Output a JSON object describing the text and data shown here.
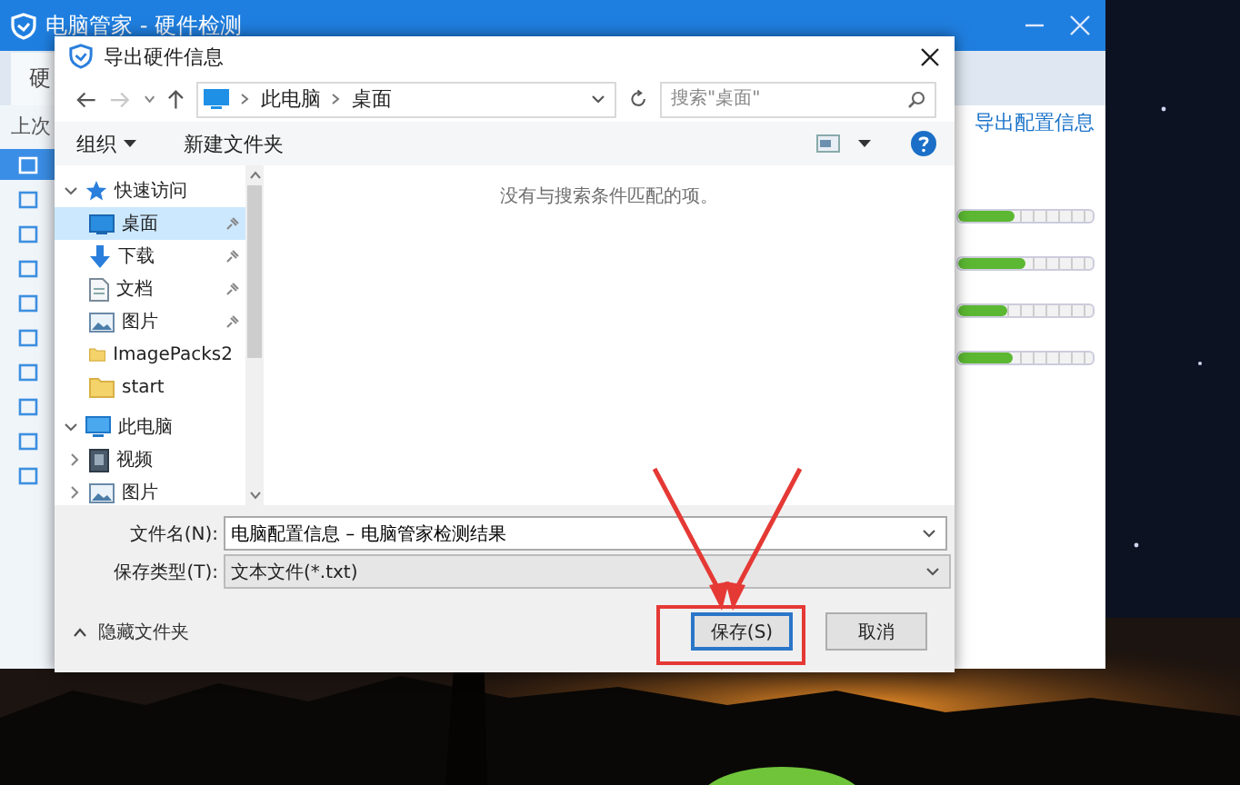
{
  "app_window": {
    "title": "电脑管家 - 硬件检测",
    "tabs": [
      {
        "label": "硬",
        "selected": true
      }
    ],
    "section_label": "上次",
    "sidebar": [
      {
        "selected": true
      },
      {
        "selected": false
      },
      {
        "selected": false
      },
      {
        "selected": false
      },
      {
        "selected": false
      },
      {
        "selected": false
      },
      {
        "selected": false
      },
      {
        "selected": false
      },
      {
        "selected": false
      },
      {
        "selected": false
      }
    ],
    "export_link": "导出配置信息",
    "meters": [
      {
        "level": 0.42
      },
      {
        "level": 0.5
      },
      {
        "level": 0.36
      },
      {
        "level": 0.4
      }
    ]
  },
  "dialog": {
    "title": "导出硬件信息",
    "breadcrumb": [
      "此电脑",
      "桌面"
    ],
    "search": {
      "placeholder": "搜索\"桌面\""
    },
    "toolbar": {
      "organize": "组织",
      "new_folder": "新建文件夹"
    },
    "nav": [
      {
        "label": "快速访问",
        "kind": "star",
        "expanded": true,
        "children": [
          {
            "label": "桌面",
            "kind": "desktop",
            "pinned": true,
            "selected": true
          },
          {
            "label": "下载",
            "kind": "download",
            "pinned": true,
            "selected": false
          },
          {
            "label": "文档",
            "kind": "document",
            "pinned": true,
            "selected": false
          },
          {
            "label": "图片",
            "kind": "picture",
            "pinned": true,
            "selected": false
          },
          {
            "label": "ImagePacks2",
            "kind": "folder",
            "pinned": false,
            "selected": false
          },
          {
            "label": "start",
            "kind": "folder",
            "pinned": false,
            "selected": false
          }
        ]
      },
      {
        "label": "此电脑",
        "kind": "computer",
        "expanded": true,
        "children": [
          {
            "label": "视频",
            "kind": "video",
            "expanded": false,
            "selected": false
          },
          {
            "label": "图片",
            "kind": "picture",
            "expanded": false,
            "selected": false
          }
        ]
      }
    ],
    "empty_message": "没有与搜索条件匹配的项。",
    "file_name": {
      "label": "文件名(N):",
      "value": "电脑配置信息 – 电脑管家检测结果"
    },
    "file_type": {
      "label": "保存类型(T):",
      "value": "文本文件(*.txt)"
    },
    "hide_folders": "隐藏文件夹",
    "buttons": [
      {
        "label": "保存(S)",
        "kind": "primary"
      },
      {
        "label": "取消",
        "kind": "normal"
      }
    ]
  }
}
